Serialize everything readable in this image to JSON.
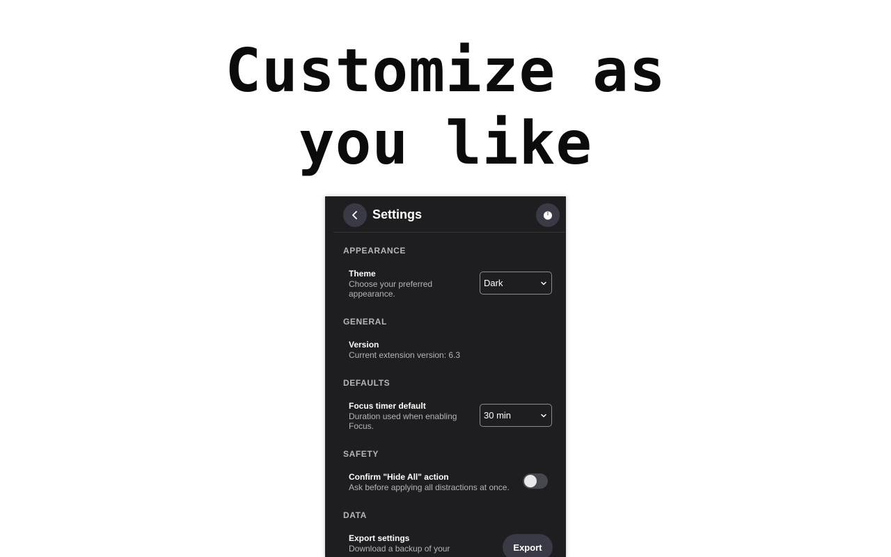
{
  "headline": {
    "line1": "Customize as",
    "line2": "you like"
  },
  "header": {
    "title": "Settings",
    "back_icon": "chevron-left-icon",
    "power_icon": "power-icon"
  },
  "sections": {
    "appearance": {
      "label": "APPEARANCE",
      "theme": {
        "title": "Theme",
        "description": "Choose your preferred appearance.",
        "value": "Dark"
      }
    },
    "general": {
      "label": "GENERAL",
      "version": {
        "title": "Version",
        "description": "Current extension version: 6.3"
      }
    },
    "defaults": {
      "label": "DEFAULTS",
      "focus_timer": {
        "title": "Focus timer default",
        "description": "Duration used when enabling Focus.",
        "value": "30 min"
      }
    },
    "safety": {
      "label": "SAFETY",
      "confirm_hide_all": {
        "title": "Confirm \"Hide All\" action",
        "description": "Ask before applying all distractions at once.",
        "enabled": false
      }
    },
    "data": {
      "label": "DATA",
      "export": {
        "title": "Export settings",
        "description": "Download a backup of your",
        "button_label": "Export"
      }
    }
  },
  "colors": {
    "panel_bg": "#1e1e20",
    "button_bg": "#3a3946",
    "section_label": "#b5b5bd"
  }
}
